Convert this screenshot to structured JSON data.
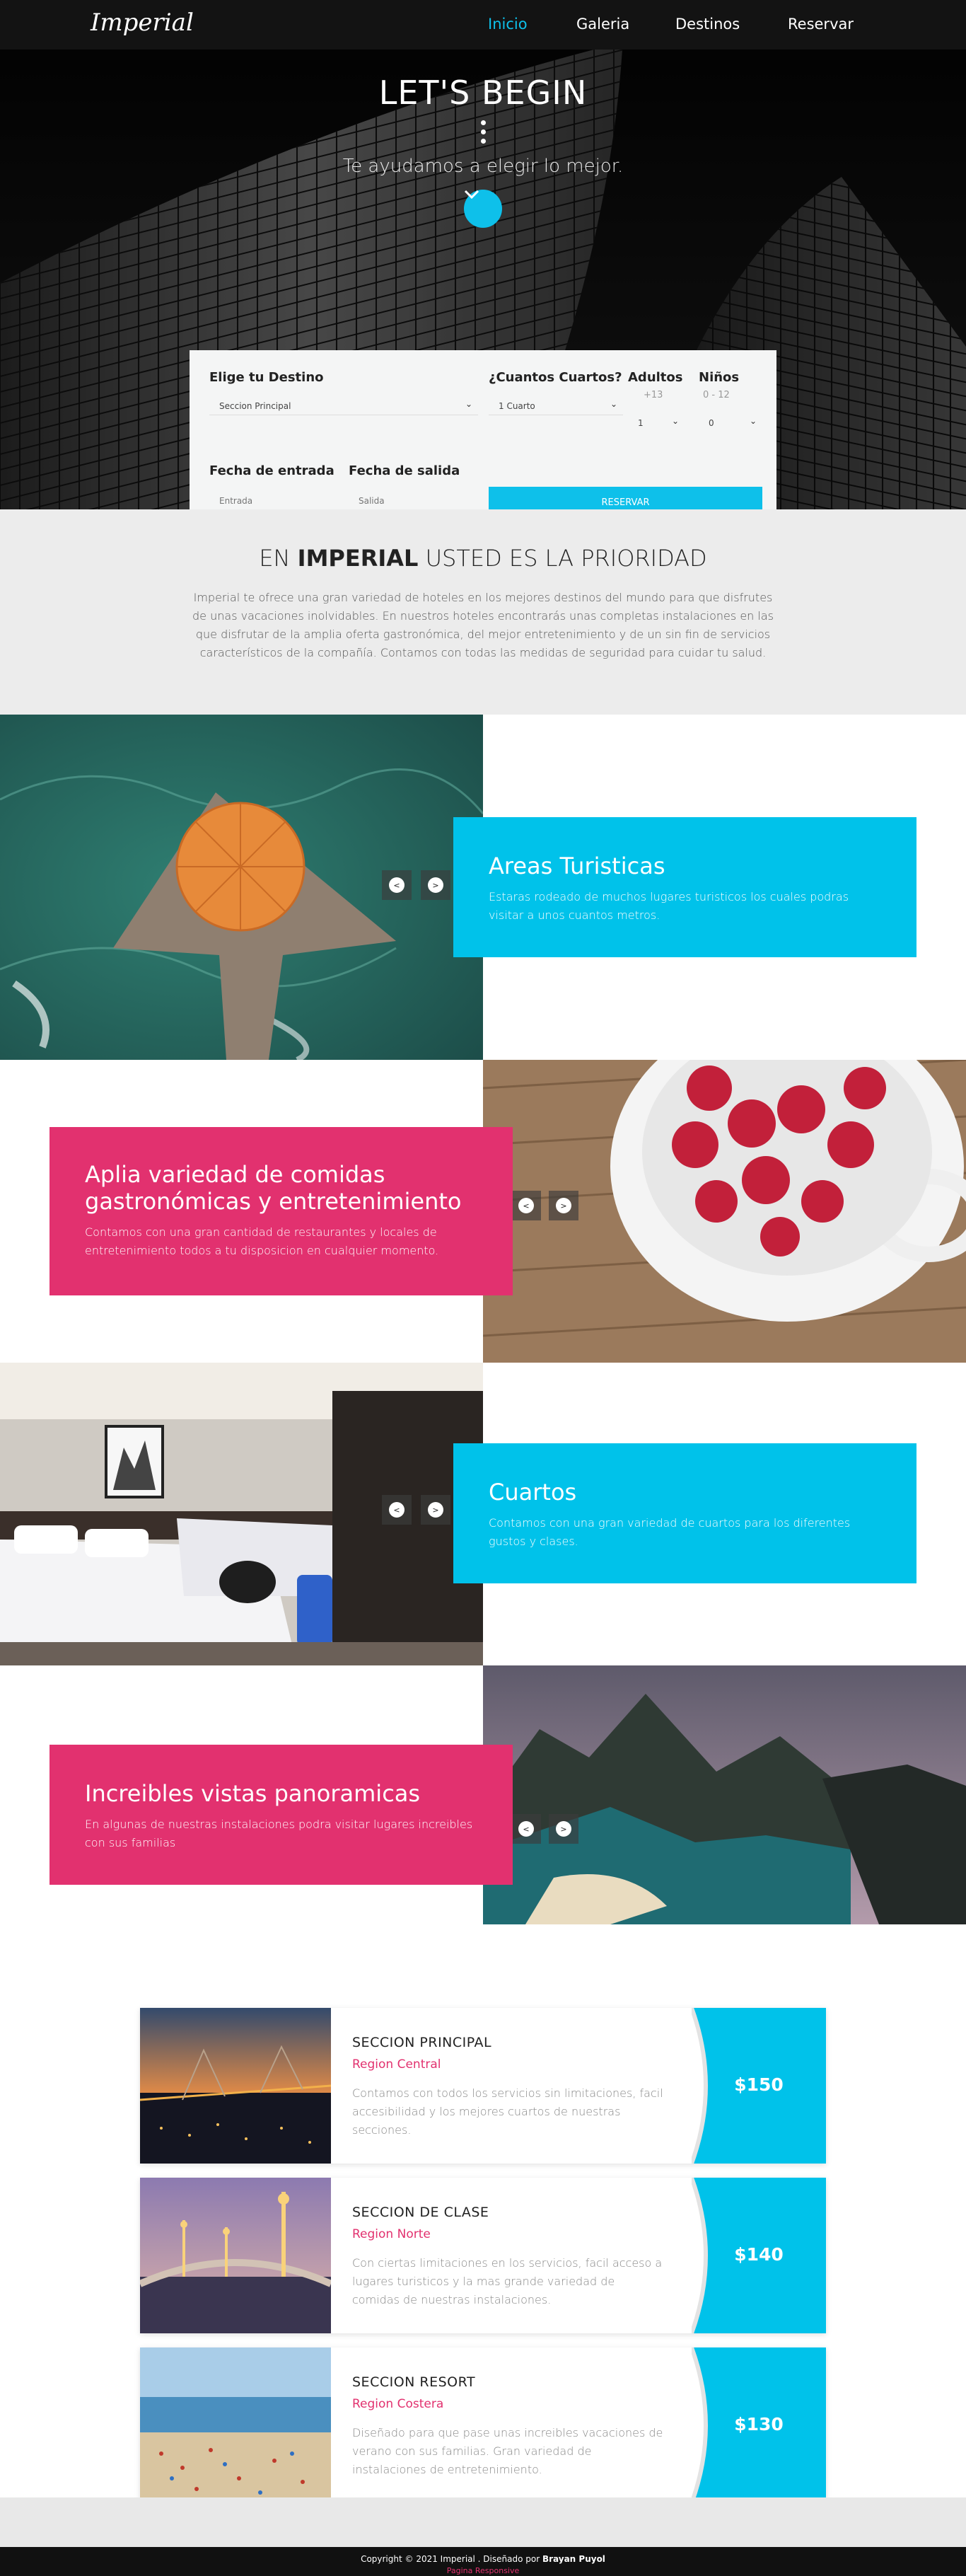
{
  "nav": {
    "logo": "Imperial",
    "links": [
      "Inicio",
      "Galeria",
      "Destinos",
      "Reservar"
    ]
  },
  "hero": {
    "title": "LET'S BEGIN",
    "subtitle": "Te ayudamos a elegir lo mejor."
  },
  "booking": {
    "destino_label": "Elige tu Destino",
    "destino_value": "Seccion Principal",
    "cuartos_label": "¿Cuantos Cuartos?",
    "cuartos_value": "1 Cuarto",
    "adultos_label": "Adultos",
    "adultos_hint": "+13",
    "adultos_value": "1",
    "ninos_label": "Niños",
    "ninos_hint": "0 - 12",
    "ninos_value": "0",
    "entrada_label": "Fecha de entrada",
    "entrada_placeholder": "Entrada",
    "salida_label": "Fecha de salida",
    "salida_placeholder": "Salida",
    "reserve_label": "RESERVAR"
  },
  "priority": {
    "title_pre": "EN ",
    "title_brand": "IMPERIAL",
    "title_post": " USTED ES LA PRIORIDAD",
    "text": "Imperial te ofrece una gran variedad de hoteles en los mejores destinos del mundo para que disfrutes de unas vacaciones inolvidables. En nuestros hoteles encontrarás unas completas instalaciones en las que disfrutar de la amplia oferta gastronómica, del mejor entretenimiento y de un sin fin de servicios característicos de la compañía. Contamos con todas las medidas de seguridad para cuidar tu salud."
  },
  "features": [
    {
      "title": "Areas Turisticas",
      "text": "Estaras rodeado de muchos lugares turisticos los cuales podras visitar a unos cuantos metros."
    },
    {
      "title": "Aplia variedad de comidas gastronómicas y entretenimiento",
      "text": "Contamos con una gran cantidad de restaurantes y locales de entretenimiento todos a tu disposicion en cualquier momento."
    },
    {
      "title": "Cuartos",
      "text": "Contamos con una gran variedad de cuartos para los diferentes gustos y clases."
    },
    {
      "title": "Increibles vistas panoramicas",
      "text": "En algunas de nuestras instalaciones podra visitar lugares increibles con sus familias"
    }
  ],
  "pricing": [
    {
      "name": "SECCION PRINCIPAL",
      "region": "Region Central",
      "text": "Contamos con todos los servicios sin limitaciones, facil accesibilidad y los mejores cuartos de nuestras secciones.",
      "price": "$150"
    },
    {
      "name": "SECCION DE CLASE",
      "region": "Region Norte",
      "text": "Con ciertas limitaciones en los servicios, facil acceso a lugares turisticos y la mas grande variedad de comidas de nuestras instalaciones.",
      "price": "$140"
    },
    {
      "name": "SECCION RESORT",
      "region": "Region Costera",
      "text": "Diseñado para que pase unas increibles vacaciones de verano con sus familias. Gran variedad de instalaciones de entretenimiento.",
      "price": "$130"
    }
  ],
  "footer": {
    "copyright_pre": "Copyright © 2021 Imperial . Diseñado por ",
    "author": "Brayan Puyol",
    "credit": "Pagina Responsive"
  },
  "colors": {
    "accent": "#0ec0ea",
    "pink": "#e2316f",
    "dark": "#131313"
  }
}
